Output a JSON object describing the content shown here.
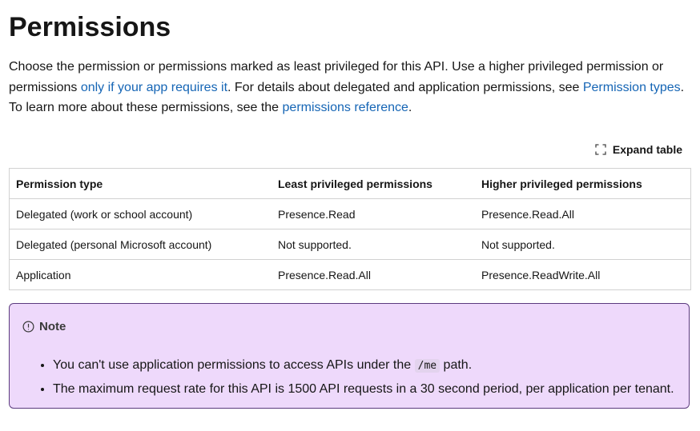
{
  "page": {
    "title": "Permissions"
  },
  "intro": {
    "text1": "Choose the permission or permissions marked as least privileged for this API. Use a higher privileged permission or permissions ",
    "link1": "only if your app requires it",
    "text2": ". For details about delegated and application permissions, see ",
    "link2": "Permission types",
    "text3": ". To learn more about these permissions, see the ",
    "link3": "permissions reference",
    "text4": "."
  },
  "toolbar": {
    "expand_icon": "expand-icon",
    "expand_label": "Expand table"
  },
  "table": {
    "headers": [
      "Permission type",
      "Least privileged permissions",
      "Higher privileged permissions"
    ],
    "rows": [
      [
        "Delegated (work or school account)",
        "Presence.Read",
        "Presence.Read.All"
      ],
      [
        "Delegated (personal Microsoft account)",
        "Not supported.",
        "Not supported."
      ],
      [
        "Application",
        "Presence.Read.All",
        "Presence.ReadWrite.All"
      ]
    ]
  },
  "note": {
    "icon": "info-icon",
    "title": "Note",
    "item1_pre": "You can't use application permissions to access APIs under the ",
    "item1_code": "/me",
    "item1_post": " path.",
    "item2": "The maximum request rate for this API is 1500 API requests in a 30 second period, per application per tenant."
  },
  "colors": {
    "link": "#1565b5",
    "note_bg": "#eed9fb",
    "note_border": "#5b3a7e",
    "text": "#161616"
  }
}
